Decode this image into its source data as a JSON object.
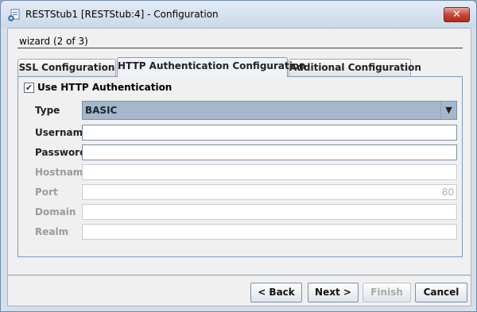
{
  "window": {
    "title": "RESTStub1 [RESTStub:4] - Configuration",
    "close_glyph": "✕"
  },
  "wizard": {
    "label": "wizard (2 of 3)"
  },
  "tabs": [
    {
      "label": "SSL Configuration",
      "active": false
    },
    {
      "label": "HTTP Authentication Configuration",
      "active": true
    },
    {
      "label": "Additional Configuration",
      "active": false
    }
  ],
  "form": {
    "use_http_auth": {
      "label": "Use HTTP Authentication",
      "checked": true,
      "check_glyph": "✔"
    },
    "type": {
      "label": "Type",
      "value": "BASIC",
      "arrow_glyph": "▼"
    },
    "username": {
      "label": "Username",
      "value": "",
      "enabled": true
    },
    "password": {
      "label": "Password",
      "value": "",
      "enabled": true
    },
    "hostname": {
      "label": "Hostname",
      "value": "",
      "enabled": false
    },
    "port": {
      "label": "Port",
      "value": "80",
      "enabled": false
    },
    "domain": {
      "label": "Domain",
      "value": "",
      "enabled": false
    },
    "realm": {
      "label": "Realm",
      "value": "",
      "enabled": false
    }
  },
  "buttons": {
    "back": "< Back",
    "next": "Next >",
    "finish": "Finish",
    "cancel": "Cancel"
  },
  "colors": {
    "titlebar": "#cad8e8",
    "close_button": "#c5483a",
    "select_bg": "#a4b8cc",
    "tab_border_active": "#7c9cc0"
  }
}
